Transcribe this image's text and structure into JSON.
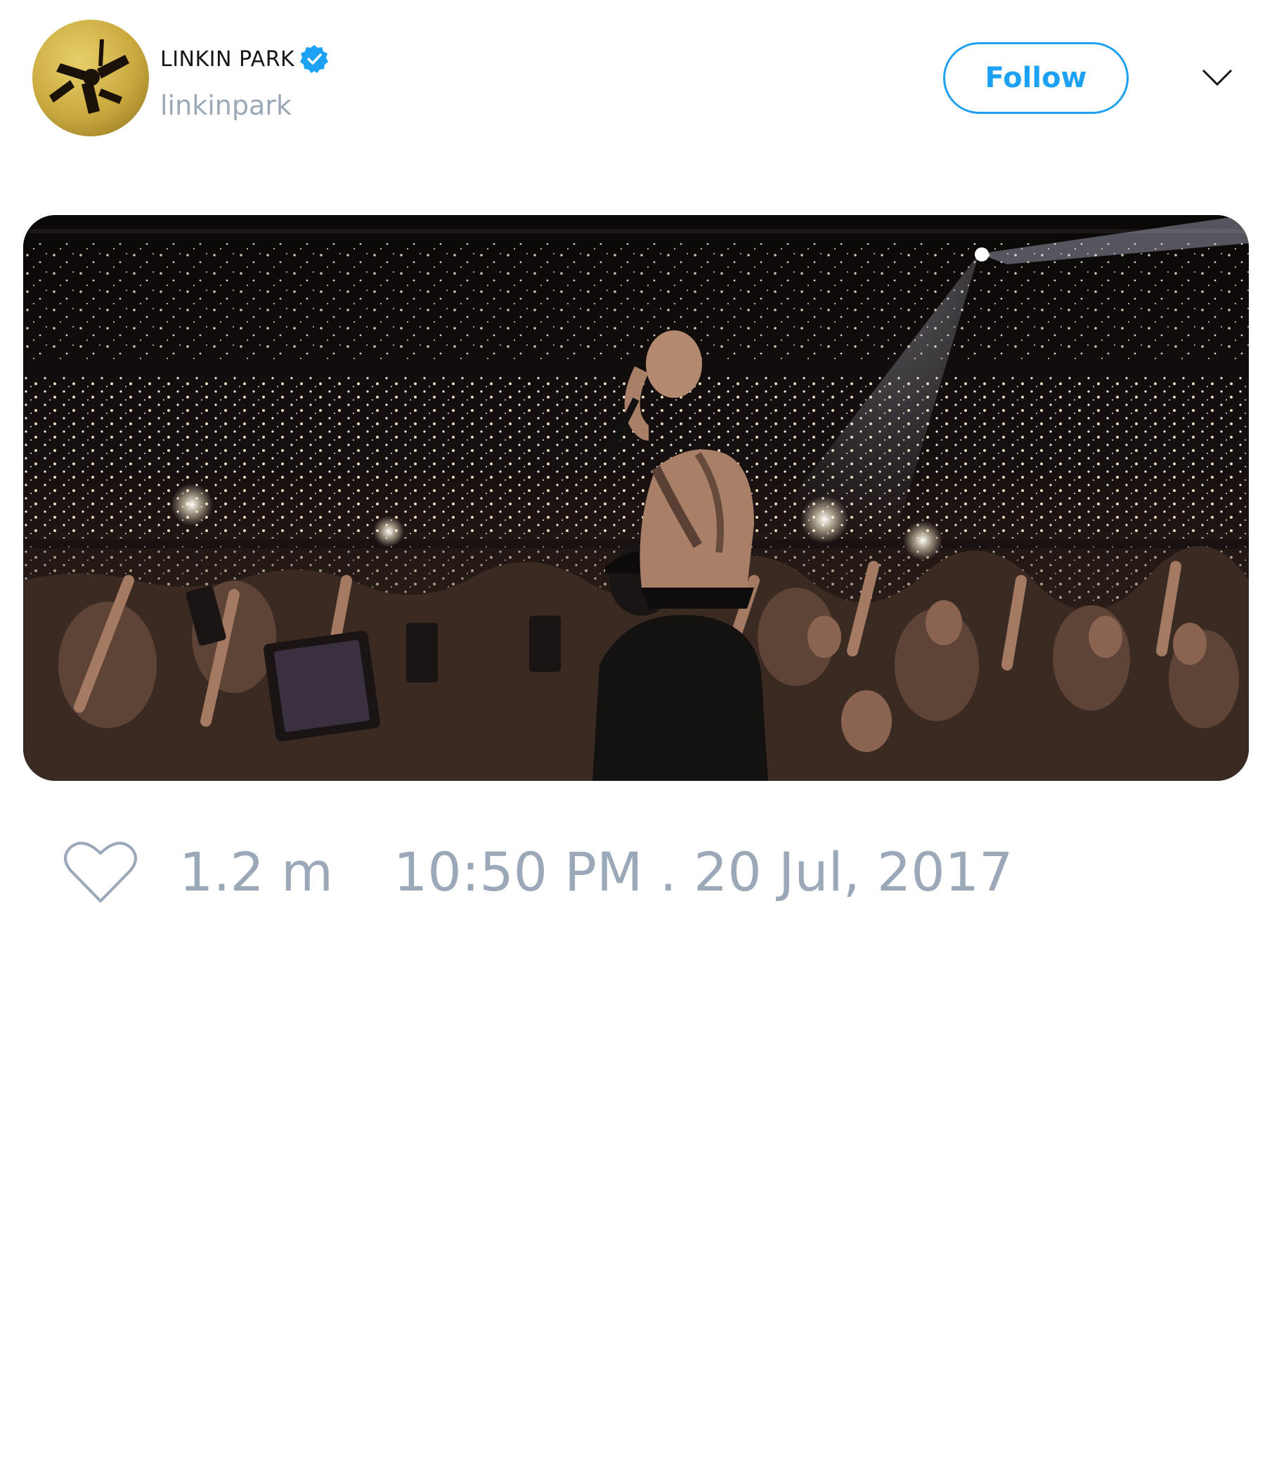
{
  "account": {
    "display_name": "LINKIN PARK",
    "handle": "linkinpark",
    "verified": true,
    "avatar_icon": "linkin-park-soldier-logo"
  },
  "header": {
    "follow_label": "Follow",
    "menu_icon": "chevron-down-icon"
  },
  "media": {
    "type": "photo",
    "icon": "concert-photo"
  },
  "footer": {
    "like_icon": "heart-icon",
    "like_count": "1.2 m",
    "timestamp": "10:50 PM . 20 Jul, 2017"
  },
  "colors": {
    "accent": "#1da1f2",
    "muted_text": "#9aa8b8",
    "primary_text": "#14171a",
    "background": "#ffffff"
  }
}
